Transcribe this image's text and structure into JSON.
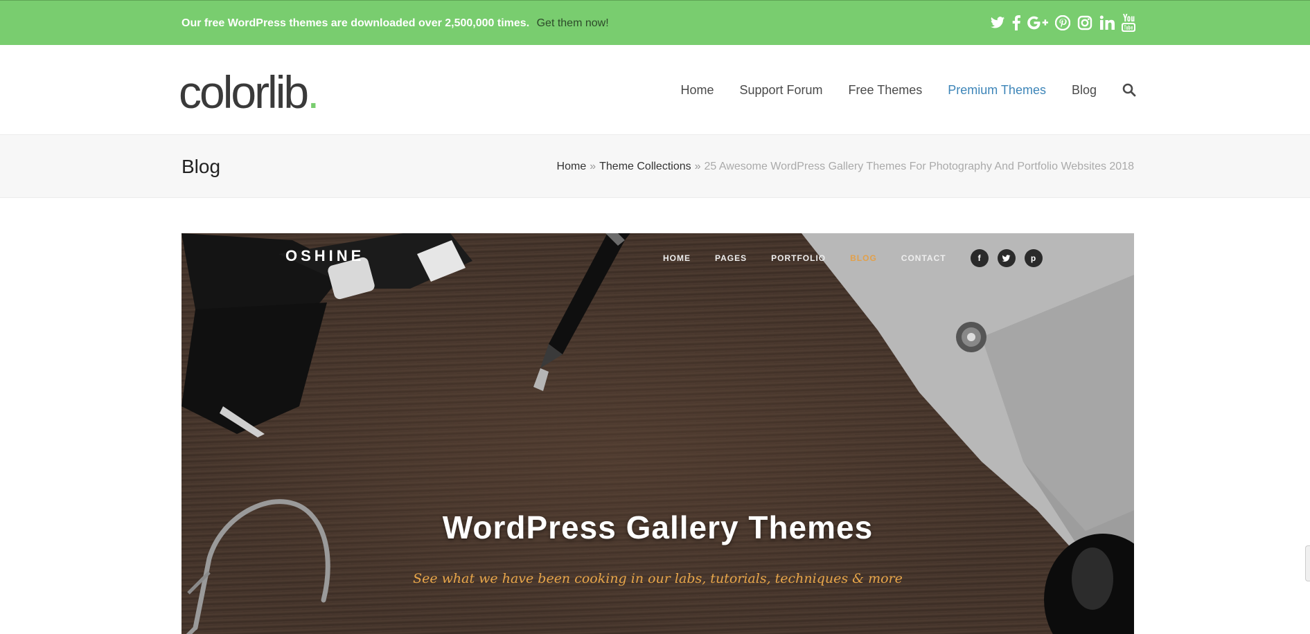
{
  "topbar": {
    "promo_text": "Our free WordPress themes are downloaded over 2,500,000 times.",
    "cta": "Get them now!",
    "social_icons": [
      "twitter-icon",
      "facebook-icon",
      "google-plus-icon",
      "pinterest-icon",
      "instagram-icon",
      "linkedin-icon",
      "youtube-icon"
    ],
    "bg_color": "#79cd6f"
  },
  "header": {
    "logo_text": "colorlib",
    "logo_dot": ".",
    "nav": [
      {
        "label": "Home"
      },
      {
        "label": "Support Forum"
      },
      {
        "label": "Free Themes"
      },
      {
        "label": "Premium Themes",
        "active": true
      },
      {
        "label": "Blog"
      }
    ],
    "active_color": "#3d85b8"
  },
  "band": {
    "title": "Blog",
    "breadcrumb": [
      "Home",
      "Theme Collections",
      "25 Awesome WordPress Gallery Themes For Photography And Portfolio Websites 2018"
    ],
    "separator": "»"
  },
  "hero": {
    "brand": "OSHINE",
    "nav": [
      {
        "label": "HOME"
      },
      {
        "label": "PAGES"
      },
      {
        "label": "PORTFOLIO"
      },
      {
        "label": "BLOG",
        "active": true
      },
      {
        "label": "CONTACT"
      }
    ],
    "social": [
      "facebook-icon",
      "twitter-icon",
      "pinterest-icon"
    ],
    "social_letters": [
      "f",
      "t",
      "p"
    ],
    "title": "WordPress Gallery Themes",
    "subtitle": "See what we have been cooking in our labs, tutorials, techniques & more",
    "accent_color": "#e2a04a"
  }
}
